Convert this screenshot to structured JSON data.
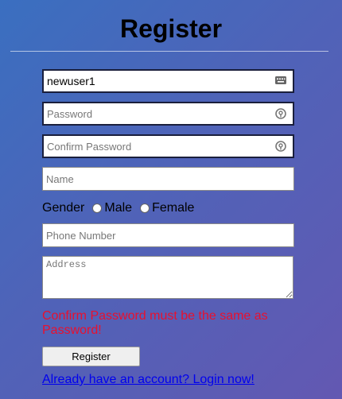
{
  "page": {
    "title": "Register"
  },
  "form": {
    "username": {
      "value": "newuser1",
      "icon": "keyboard-icon"
    },
    "password": {
      "placeholder": "Password",
      "icon": "password-reveal-icon"
    },
    "confirm_password": {
      "placeholder": "Confirm Password",
      "icon": "password-reveal-icon"
    },
    "name": {
      "placeholder": "Name"
    },
    "gender": {
      "label": "Gender",
      "options": [
        "Male",
        "Female"
      ]
    },
    "phone": {
      "placeholder": "Phone Number"
    },
    "address": {
      "placeholder": "Address"
    },
    "error_message": "Confirm Password must be the same as Password!",
    "submit_label": "Register",
    "login_link": "Already have an account? Login now!"
  },
  "colors": {
    "background_start": "#3a6fc0",
    "background_end": "#6358b2",
    "error": "#e8102f",
    "link": "#0000ee"
  }
}
